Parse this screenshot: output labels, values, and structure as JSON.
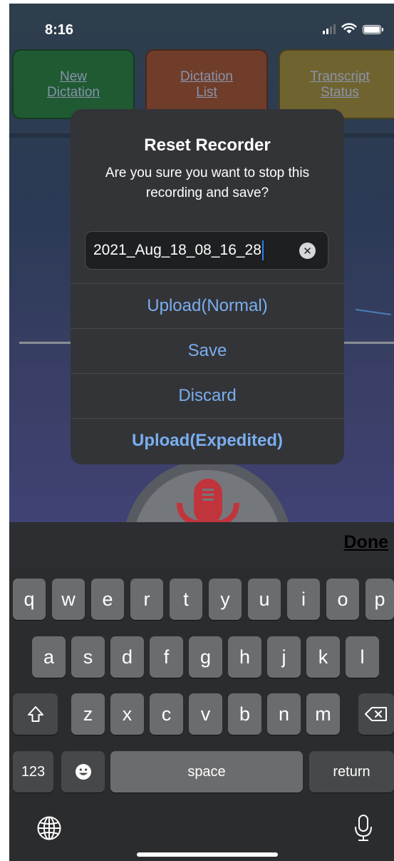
{
  "status_bar": {
    "time": "8:16"
  },
  "nav": [
    {
      "label_line1": "New",
      "label_line2": "Dictation"
    },
    {
      "label_line1": "Dictation",
      "label_line2": "List"
    },
    {
      "label_line1": "Transcript",
      "label_line2": "Status"
    }
  ],
  "alert": {
    "title": "Reset Recorder",
    "message": "Are you sure you want to stop this recording and save?",
    "field_value": "2021_Aug_18_08_16_28",
    "actions": [
      {
        "label": "Upload(Normal)"
      },
      {
        "label": "Save"
      },
      {
        "label": "Discard"
      },
      {
        "label": "Upload(Expedited)"
      }
    ]
  },
  "keyboard": {
    "done_label": "Done",
    "row1": [
      "q",
      "w",
      "e",
      "r",
      "t",
      "y",
      "u",
      "i",
      "o",
      "p"
    ],
    "row2": [
      "a",
      "s",
      "d",
      "f",
      "g",
      "h",
      "j",
      "k",
      "l"
    ],
    "row3": [
      "z",
      "x",
      "c",
      "v",
      "b",
      "n",
      "m"
    ],
    "numbers_label": "123",
    "space_label": "space",
    "return_label": "return"
  },
  "colors": {
    "action_blue": "#7aaef0",
    "alert_bg": "#333437",
    "mic_red": "#c0353b",
    "nav_green": "#1f5a33",
    "nav_orange": "#6f3d2a",
    "nav_yellow": "#6f6330"
  },
  "icons": [
    "cellular-signal-icon",
    "wifi-icon",
    "battery-icon",
    "microphone-icon",
    "clear-text-icon",
    "shift-icon",
    "backspace-icon",
    "emoji-icon",
    "globe-icon",
    "dictation-mic-icon"
  ]
}
